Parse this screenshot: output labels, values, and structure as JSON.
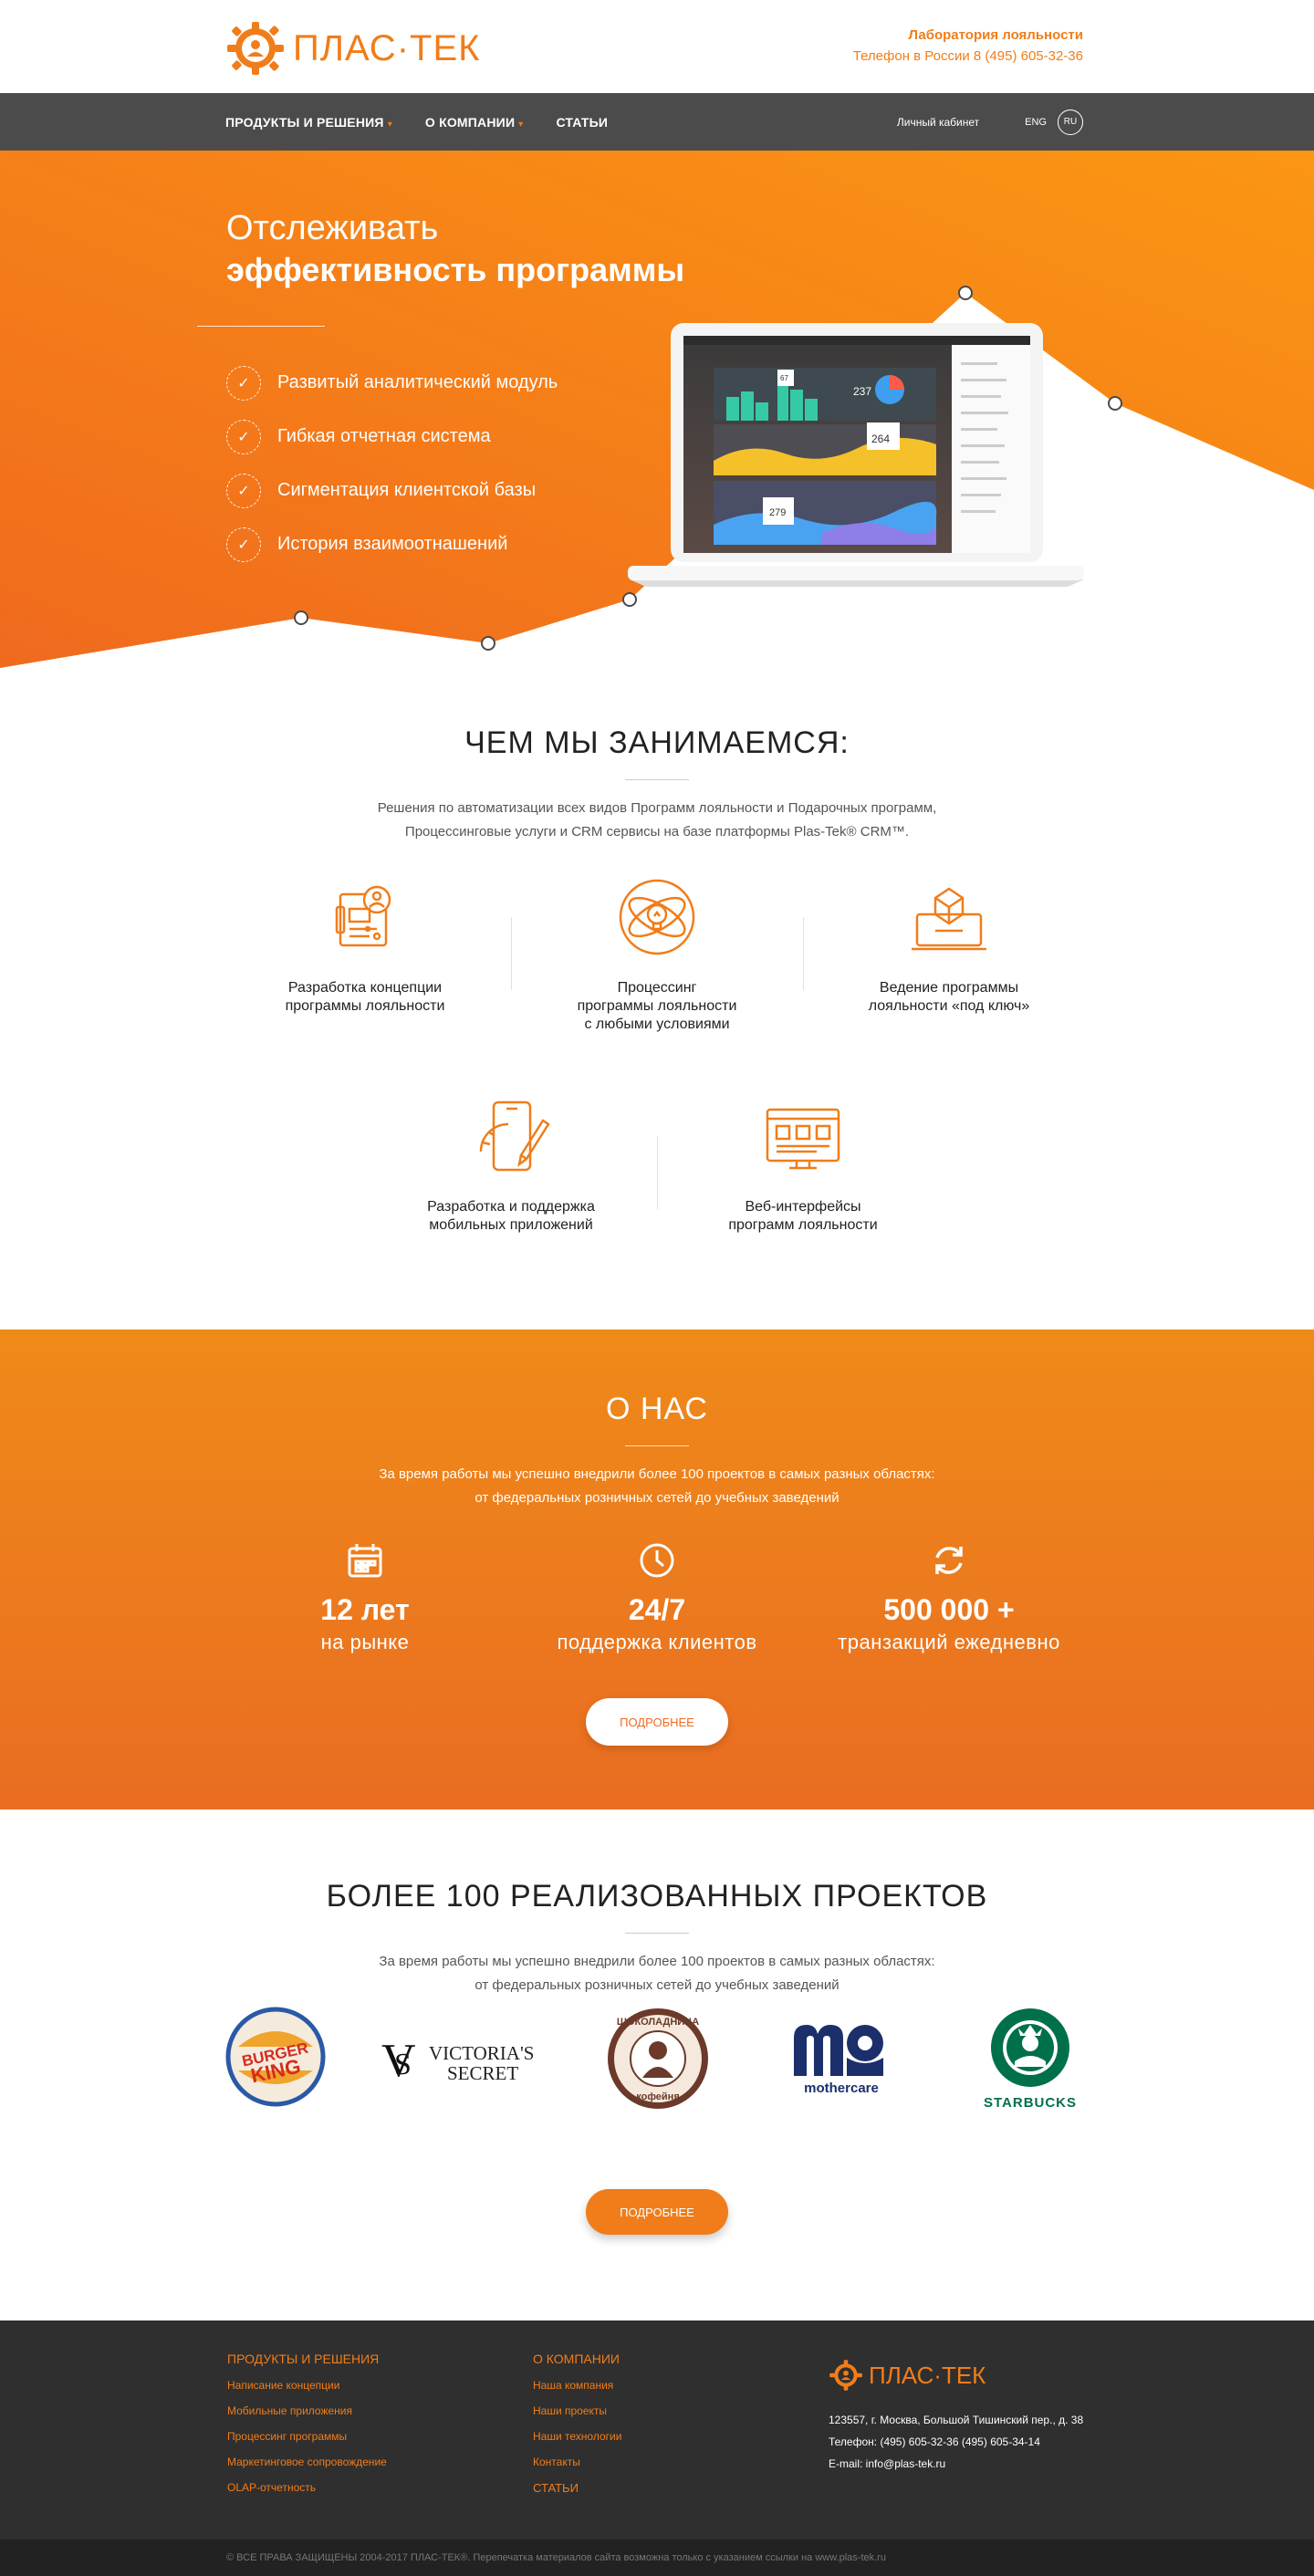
{
  "header": {
    "brand": "ПЛАС·ТЕК",
    "lab_title": "Лаборатория лояльности",
    "phone": "Телефон в России 8 (495) 605-32-36"
  },
  "nav": {
    "items": [
      {
        "label": "ПРОДУКТЫ И РЕШЕНИЯ",
        "has_dropdown": true
      },
      {
        "label": "О КОМПАНИИ",
        "has_dropdown": true
      },
      {
        "label": "СТАТЬИ",
        "has_dropdown": false
      }
    ],
    "cabinet": "Личный кабинет",
    "lang_en": "ENG",
    "lang_ru": "RU"
  },
  "hero": {
    "title_line1": "Отслеживать",
    "title_line2": "эффективность программы",
    "features": [
      "Развитый аналитический модуль",
      "Гибкая отчетная система",
      "Сигментация клиентской базы",
      "История взаимоотнашений"
    ],
    "dashboard_values": [
      "237",
      "67",
      "264",
      "279"
    ]
  },
  "what": {
    "title": "ЧЕМ МЫ ЗАНИМАЕМСЯ:",
    "text_line1": "Решения по автоматизации всех видов Программ лояльности и Подарочных программ,",
    "text_line2": "Процессинговые услуги и CRM сервисы на базе платформы Plas-Tek® CRM™.",
    "services": [
      {
        "l1": "Разработка концепции",
        "l2": "программы лояльности",
        "l3": "",
        "icon": "concept-icon"
      },
      {
        "l1": "Процессинг",
        "l2": "программы лояльности",
        "l3": "с любыми условиями",
        "icon": "processing-icon"
      },
      {
        "l1": "Ведение программы",
        "l2": "лояльности «под ключ»",
        "l3": "",
        "icon": "turnkey-icon"
      },
      {
        "l1": "Разработка и поддержка",
        "l2": "мобильных приложений",
        "l3": "",
        "icon": "mobile-app-icon"
      },
      {
        "l1": "Веб-интерфейсы",
        "l2": "программ лояльности",
        "l3": "",
        "icon": "web-interface-icon"
      }
    ]
  },
  "about": {
    "title": "О НАС",
    "text_line1": "За время работы мы успешно внедрили более 100 проектов в самых разных областях:",
    "text_line2": "от федеральных розничных сетей до учебных заведений",
    "stats": [
      {
        "big": "12 лет",
        "small": "на рынке",
        "icon": "calendar-icon"
      },
      {
        "big": "24/7",
        "small": "поддержка клиентов",
        "icon": "clock-icon"
      },
      {
        "big": "500 000 +",
        "small": "транзакций ежедневно",
        "icon": "refresh-icon"
      }
    ],
    "button": "ПОДРОБНЕЕ"
  },
  "projects": {
    "title": "БОЛЕЕ 100 РЕАЛИЗОВАННЫХ ПРОЕКТОВ",
    "text_line1": "За время работы мы успешно внедрили более 100 проектов в самых разных областях:",
    "text_line2": "от федеральных розничных сетей до учебных заведений",
    "logos": {
      "bk1": "BURGER",
      "bk2": "KING",
      "vs1": "VICTORIA'S",
      "vs2": "SECRET",
      "shok_top": "ШОКОЛАДНИЦА",
      "shok_bottom": "кофейня",
      "mothercare": "mothercare",
      "starbucks": "STARBUCKS"
    },
    "button": "ПОДРОБНЕЕ"
  },
  "footer": {
    "col1": {
      "title": "ПРОДУКТЫ И РЕШЕНИЯ",
      "links": [
        "Написание концепции",
        "Мобильные приложения",
        "Процессинг программы",
        "Маркетинговое сопровождение",
        "OLAP-отчетность"
      ]
    },
    "col2": {
      "title": "О КОМПАНИИ",
      "links": [
        "Наша компания",
        "Наши проекты",
        "Наши технологии",
        "Контакты"
      ],
      "extra": "СТАТЬИ"
    },
    "brand": "ПЛАС·ТЕК",
    "address": "123557, г. Москва, Большой Тишинский пер., д. 38",
    "phones": "Телефон: (495) 605-32-36 (495) 605-34-14",
    "email": "E-mail: info@plas-tek.ru",
    "copyright": "© ВСЕ ПРАВА ЗАЩИЩЕНЫ 2004-2017 ПЛАС-ТЕК®. Перепечатка материалов сайта возможна только с указанием ссылки на www.plas-tek.ru"
  },
  "colors": {
    "accent": "#f07d1a",
    "nav_bg": "#4b4b4b",
    "footer_bg": "#2f2f2f"
  }
}
